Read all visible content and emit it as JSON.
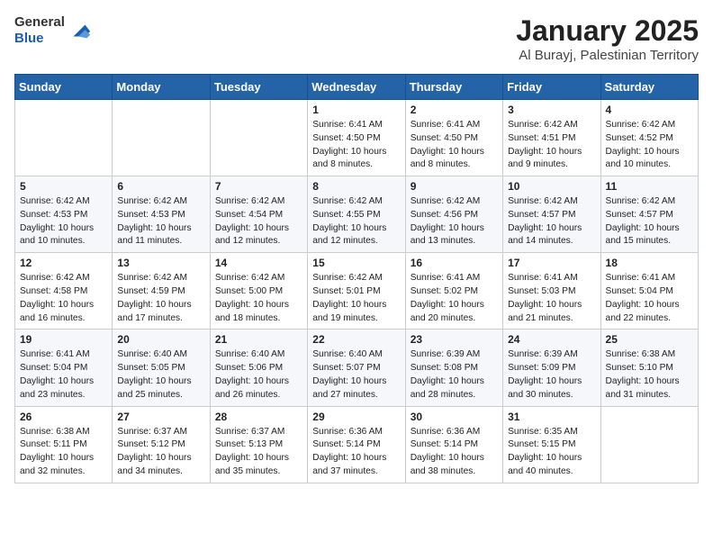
{
  "header": {
    "logo_general": "General",
    "logo_blue": "Blue",
    "title": "January 2025",
    "subtitle": "Al Burayj, Palestinian Territory"
  },
  "calendar": {
    "weekdays": [
      "Sunday",
      "Monday",
      "Tuesday",
      "Wednesday",
      "Thursday",
      "Friday",
      "Saturday"
    ],
    "weeks": [
      [
        {
          "day": "",
          "detail": ""
        },
        {
          "day": "",
          "detail": ""
        },
        {
          "day": "",
          "detail": ""
        },
        {
          "day": "1",
          "detail": "Sunrise: 6:41 AM\nSunset: 4:50 PM\nDaylight: 10 hours\nand 8 minutes."
        },
        {
          "day": "2",
          "detail": "Sunrise: 6:41 AM\nSunset: 4:50 PM\nDaylight: 10 hours\nand 8 minutes."
        },
        {
          "day": "3",
          "detail": "Sunrise: 6:42 AM\nSunset: 4:51 PM\nDaylight: 10 hours\nand 9 minutes."
        },
        {
          "day": "4",
          "detail": "Sunrise: 6:42 AM\nSunset: 4:52 PM\nDaylight: 10 hours\nand 10 minutes."
        }
      ],
      [
        {
          "day": "5",
          "detail": "Sunrise: 6:42 AM\nSunset: 4:53 PM\nDaylight: 10 hours\nand 10 minutes."
        },
        {
          "day": "6",
          "detail": "Sunrise: 6:42 AM\nSunset: 4:53 PM\nDaylight: 10 hours\nand 11 minutes."
        },
        {
          "day": "7",
          "detail": "Sunrise: 6:42 AM\nSunset: 4:54 PM\nDaylight: 10 hours\nand 12 minutes."
        },
        {
          "day": "8",
          "detail": "Sunrise: 6:42 AM\nSunset: 4:55 PM\nDaylight: 10 hours\nand 12 minutes."
        },
        {
          "day": "9",
          "detail": "Sunrise: 6:42 AM\nSunset: 4:56 PM\nDaylight: 10 hours\nand 13 minutes."
        },
        {
          "day": "10",
          "detail": "Sunrise: 6:42 AM\nSunset: 4:57 PM\nDaylight: 10 hours\nand 14 minutes."
        },
        {
          "day": "11",
          "detail": "Sunrise: 6:42 AM\nSunset: 4:57 PM\nDaylight: 10 hours\nand 15 minutes."
        }
      ],
      [
        {
          "day": "12",
          "detail": "Sunrise: 6:42 AM\nSunset: 4:58 PM\nDaylight: 10 hours\nand 16 minutes."
        },
        {
          "day": "13",
          "detail": "Sunrise: 6:42 AM\nSunset: 4:59 PM\nDaylight: 10 hours\nand 17 minutes."
        },
        {
          "day": "14",
          "detail": "Sunrise: 6:42 AM\nSunset: 5:00 PM\nDaylight: 10 hours\nand 18 minutes."
        },
        {
          "day": "15",
          "detail": "Sunrise: 6:42 AM\nSunset: 5:01 PM\nDaylight: 10 hours\nand 19 minutes."
        },
        {
          "day": "16",
          "detail": "Sunrise: 6:41 AM\nSunset: 5:02 PM\nDaylight: 10 hours\nand 20 minutes."
        },
        {
          "day": "17",
          "detail": "Sunrise: 6:41 AM\nSunset: 5:03 PM\nDaylight: 10 hours\nand 21 minutes."
        },
        {
          "day": "18",
          "detail": "Sunrise: 6:41 AM\nSunset: 5:04 PM\nDaylight: 10 hours\nand 22 minutes."
        }
      ],
      [
        {
          "day": "19",
          "detail": "Sunrise: 6:41 AM\nSunset: 5:04 PM\nDaylight: 10 hours\nand 23 minutes."
        },
        {
          "day": "20",
          "detail": "Sunrise: 6:40 AM\nSunset: 5:05 PM\nDaylight: 10 hours\nand 25 minutes."
        },
        {
          "day": "21",
          "detail": "Sunrise: 6:40 AM\nSunset: 5:06 PM\nDaylight: 10 hours\nand 26 minutes."
        },
        {
          "day": "22",
          "detail": "Sunrise: 6:40 AM\nSunset: 5:07 PM\nDaylight: 10 hours\nand 27 minutes."
        },
        {
          "day": "23",
          "detail": "Sunrise: 6:39 AM\nSunset: 5:08 PM\nDaylight: 10 hours\nand 28 minutes."
        },
        {
          "day": "24",
          "detail": "Sunrise: 6:39 AM\nSunset: 5:09 PM\nDaylight: 10 hours\nand 30 minutes."
        },
        {
          "day": "25",
          "detail": "Sunrise: 6:38 AM\nSunset: 5:10 PM\nDaylight: 10 hours\nand 31 minutes."
        }
      ],
      [
        {
          "day": "26",
          "detail": "Sunrise: 6:38 AM\nSunset: 5:11 PM\nDaylight: 10 hours\nand 32 minutes."
        },
        {
          "day": "27",
          "detail": "Sunrise: 6:37 AM\nSunset: 5:12 PM\nDaylight: 10 hours\nand 34 minutes."
        },
        {
          "day": "28",
          "detail": "Sunrise: 6:37 AM\nSunset: 5:13 PM\nDaylight: 10 hours\nand 35 minutes."
        },
        {
          "day": "29",
          "detail": "Sunrise: 6:36 AM\nSunset: 5:14 PM\nDaylight: 10 hours\nand 37 minutes."
        },
        {
          "day": "30",
          "detail": "Sunrise: 6:36 AM\nSunset: 5:14 PM\nDaylight: 10 hours\nand 38 minutes."
        },
        {
          "day": "31",
          "detail": "Sunrise: 6:35 AM\nSunset: 5:15 PM\nDaylight: 10 hours\nand 40 minutes."
        },
        {
          "day": "",
          "detail": ""
        }
      ]
    ]
  }
}
